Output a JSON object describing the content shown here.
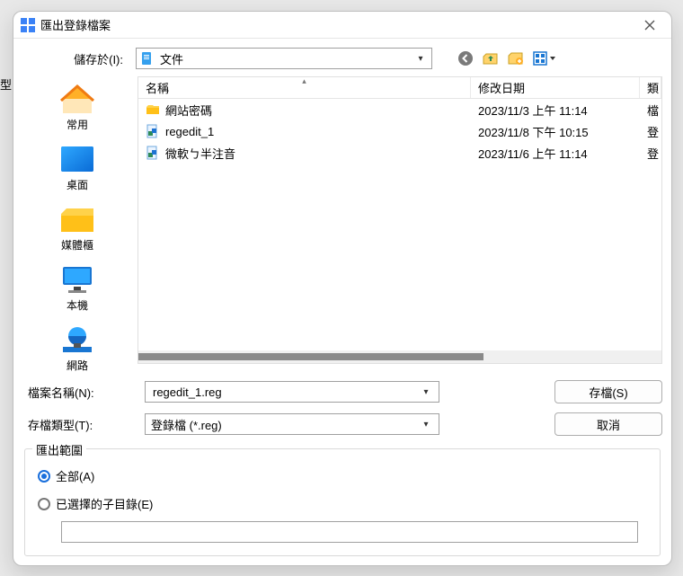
{
  "bg_partial": "型",
  "title": "匯出登錄檔案",
  "lookin": {
    "label": "儲存於(I):",
    "value": "文件"
  },
  "toolbar": {
    "back": "back-icon",
    "up": "up-icon",
    "newfolder": "new-folder-icon",
    "views": "views-icon"
  },
  "sidebar": [
    {
      "key": "recent",
      "label": "常用"
    },
    {
      "key": "desktop",
      "label": "桌面"
    },
    {
      "key": "library",
      "label": "媒體櫃"
    },
    {
      "key": "thispc",
      "label": "本機"
    },
    {
      "key": "network",
      "label": "網路"
    }
  ],
  "columns": {
    "name": "名稱",
    "date": "修改日期",
    "type": "類"
  },
  "rows": [
    {
      "icon": "folder",
      "name": "網站密碼",
      "date": "2023/11/3 上午 11:14",
      "type": "檔"
    },
    {
      "icon": "reg",
      "name": "regedit_1",
      "date": "2023/11/8 下午 10:15",
      "type": "登"
    },
    {
      "icon": "reg",
      "name": "微軟ㄅ半注音",
      "date": "2023/11/6 上午 11:14",
      "type": "登"
    }
  ],
  "filename": {
    "label": "檔案名稱(N):",
    "value": "regedit_1.reg"
  },
  "filetype": {
    "label": "存檔類型(T):",
    "value": "登錄檔 (*.reg)"
  },
  "buttons": {
    "save": "存檔(S)",
    "cancel": "取消"
  },
  "range": {
    "legend": "匯出範圍",
    "all": "全部(A)",
    "selected": "已選擇的子目錄(E)",
    "branch_value": ""
  }
}
